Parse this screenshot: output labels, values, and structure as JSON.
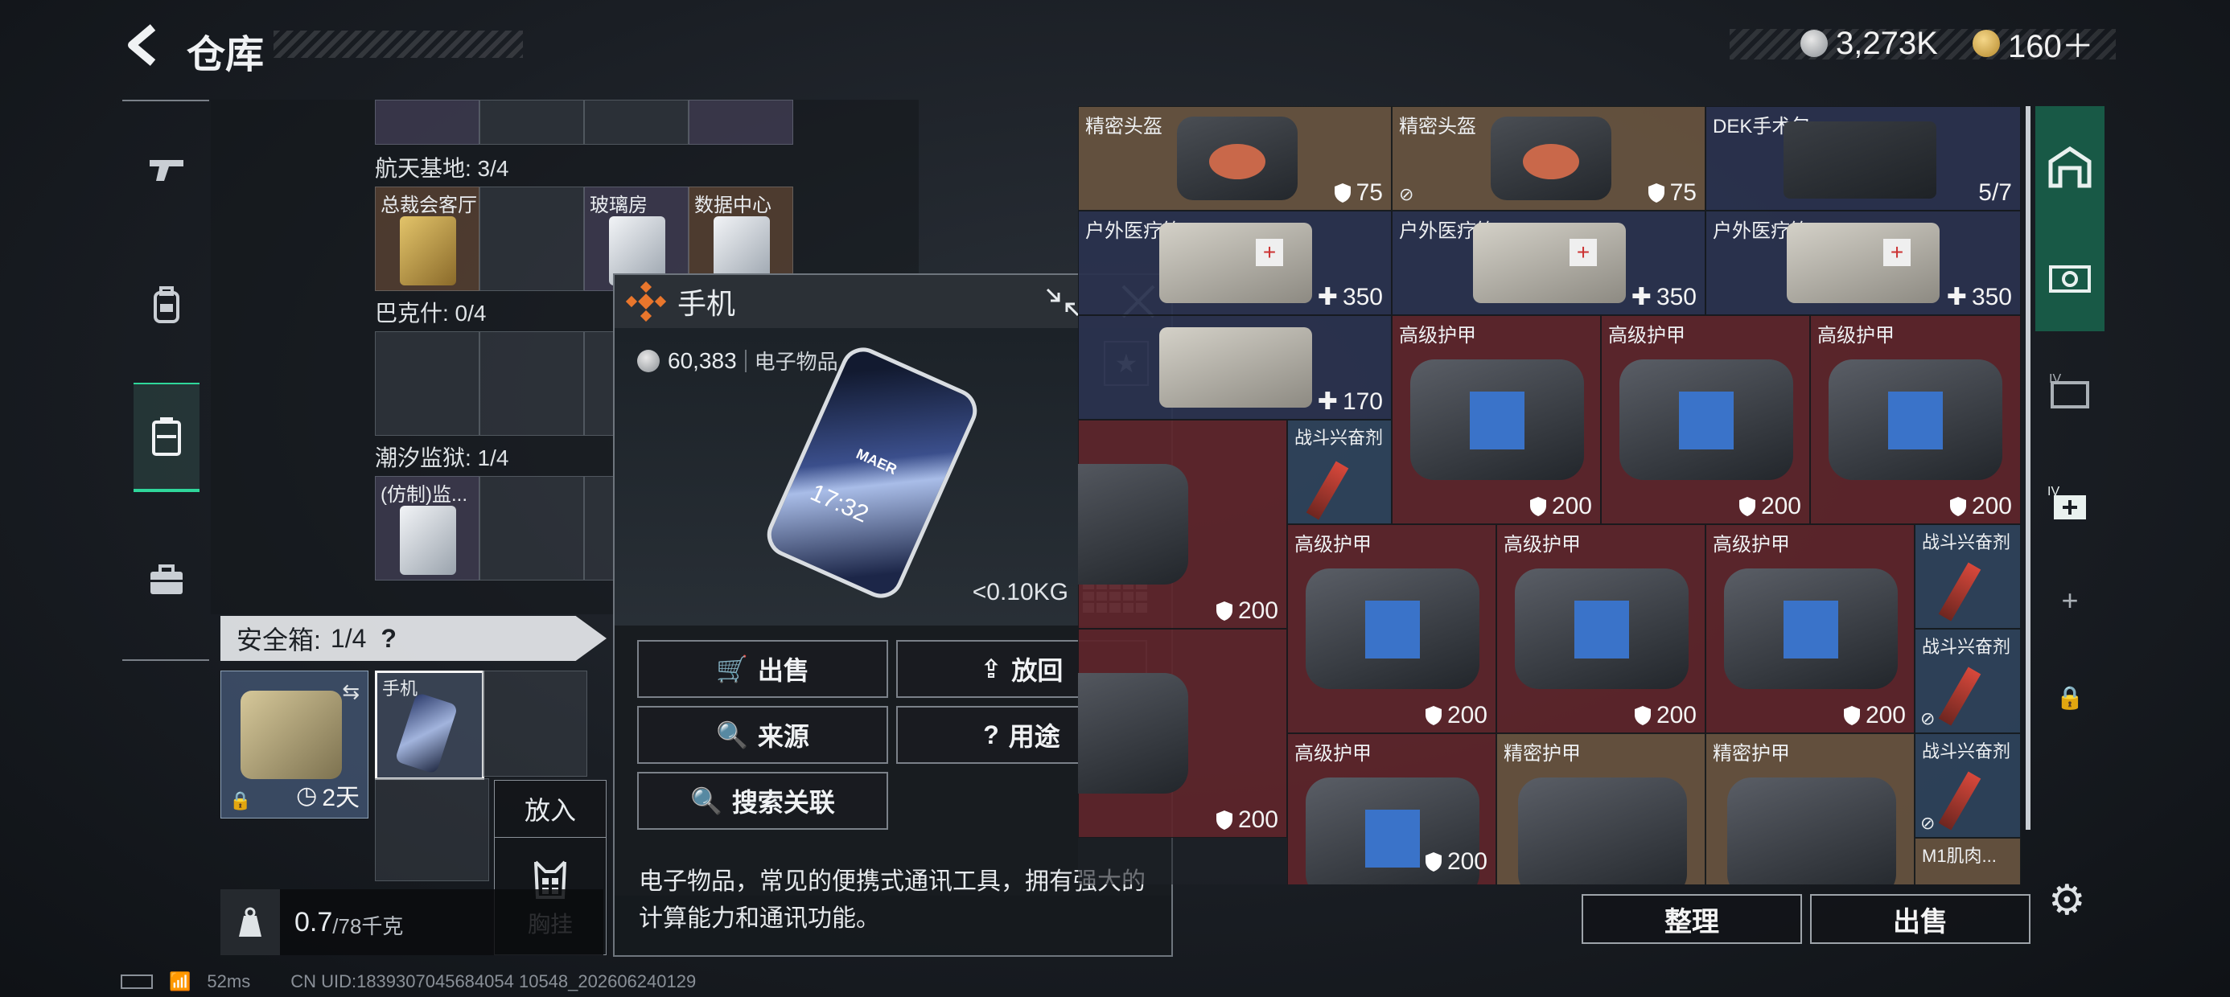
{
  "header": {
    "title": "仓库",
    "currency_silver": "3,273K",
    "currency_gold": "160＋",
    "accent": "#2fd79b"
  },
  "left_tabs": [
    {
      "icon": "gun-icon"
    },
    {
      "icon": "backpack-icon"
    },
    {
      "icon": "storage-box-icon",
      "active": true
    },
    {
      "icon": "briefcase-icon"
    }
  ],
  "storage": {
    "sections": [
      {
        "label": "航天基地: 3/4",
        "slots": [
          "总裁会客厅",
          "",
          "玻璃房",
          "数据中心"
        ]
      },
      {
        "label": "巴克什: 0/4"
      },
      {
        "label": "潮汐监狱: 1/4",
        "slots": [
          "(仿制)监..."
        ]
      }
    ]
  },
  "safe_box": {
    "header": "安全箱:",
    "count": "1/4",
    "help": "?",
    "timer": "2天",
    "item_label": "手机"
  },
  "weight": {
    "current": "0.7",
    "max": "/78千克"
  },
  "put_in": {
    "label": "放入",
    "sub_label": "胸挂"
  },
  "popup": {
    "title": "手机",
    "price": "60,383",
    "category": "电子物品",
    "weight": "<0.10KG",
    "phone_brand": "MAER",
    "phone_time": "17:32",
    "buttons": {
      "sell": "出售",
      "return": "放回",
      "source": "来源",
      "usage": "用途",
      "search": "搜索关联"
    },
    "description": "电子物品，常见的便携式通讯工具，拥有强大的计算能力和通讯功能。"
  },
  "grid_items": [
    {
      "name": "精密头盔",
      "value": "75"
    },
    {
      "name": "精密头盔",
      "value": "75"
    },
    {
      "name": "DEK手术包",
      "value": "5/7"
    },
    {
      "name": "户外医疗箱",
      "value": "350"
    },
    {
      "name": "户外医疗箱",
      "value": "350"
    },
    {
      "name": "户外医疗箱",
      "value": "350"
    },
    {
      "name": "",
      "value": "170"
    },
    {
      "name": "高级护甲",
      "value": "200"
    },
    {
      "name": "高级护甲",
      "value": "200"
    },
    {
      "name": "高级护甲",
      "value": "200"
    },
    {
      "name": "战斗兴奋剂",
      "value": ""
    },
    {
      "name": "",
      "value": "200"
    },
    {
      "name": "高级护甲",
      "value": "200"
    },
    {
      "name": "高级护甲",
      "value": "200"
    },
    {
      "name": "高级护甲",
      "value": "200"
    },
    {
      "name": "战斗兴奋剂",
      "value": ""
    },
    {
      "name": "战斗兴奋剂",
      "value": ""
    },
    {
      "name": "",
      "value": "200"
    },
    {
      "name": "高级护甲",
      "value": "200"
    },
    {
      "name": "精密护甲",
      "value": ""
    },
    {
      "name": "精密护甲",
      "value": ""
    },
    {
      "name": "战斗兴奋剂",
      "value": ""
    },
    {
      "name": "M1肌肉...",
      "value": ""
    }
  ],
  "bottom_buttons": {
    "organize": "整理",
    "sell": "出售"
  },
  "status_bar": {
    "ping": "52ms",
    "uid": "CN UID:1839307045684054 10548_202606240129"
  }
}
